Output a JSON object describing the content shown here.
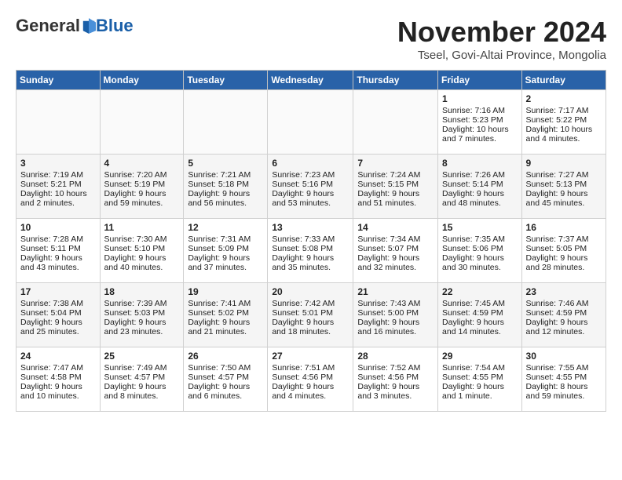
{
  "header": {
    "logo_general": "General",
    "logo_blue": "Blue",
    "month_title": "November 2024",
    "location": "Tseel, Govi-Altai Province, Mongolia"
  },
  "weekdays": [
    "Sunday",
    "Monday",
    "Tuesday",
    "Wednesday",
    "Thursday",
    "Friday",
    "Saturday"
  ],
  "weeks": [
    [
      {
        "day": "",
        "content": ""
      },
      {
        "day": "",
        "content": ""
      },
      {
        "day": "",
        "content": ""
      },
      {
        "day": "",
        "content": ""
      },
      {
        "day": "",
        "content": ""
      },
      {
        "day": "1",
        "content": "Sunrise: 7:16 AM\nSunset: 5:23 PM\nDaylight: 10 hours and 7 minutes."
      },
      {
        "day": "2",
        "content": "Sunrise: 7:17 AM\nSunset: 5:22 PM\nDaylight: 10 hours and 4 minutes."
      }
    ],
    [
      {
        "day": "3",
        "content": "Sunrise: 7:19 AM\nSunset: 5:21 PM\nDaylight: 10 hours and 2 minutes."
      },
      {
        "day": "4",
        "content": "Sunrise: 7:20 AM\nSunset: 5:19 PM\nDaylight: 9 hours and 59 minutes."
      },
      {
        "day": "5",
        "content": "Sunrise: 7:21 AM\nSunset: 5:18 PM\nDaylight: 9 hours and 56 minutes."
      },
      {
        "day": "6",
        "content": "Sunrise: 7:23 AM\nSunset: 5:16 PM\nDaylight: 9 hours and 53 minutes."
      },
      {
        "day": "7",
        "content": "Sunrise: 7:24 AM\nSunset: 5:15 PM\nDaylight: 9 hours and 51 minutes."
      },
      {
        "day": "8",
        "content": "Sunrise: 7:26 AM\nSunset: 5:14 PM\nDaylight: 9 hours and 48 minutes."
      },
      {
        "day": "9",
        "content": "Sunrise: 7:27 AM\nSunset: 5:13 PM\nDaylight: 9 hours and 45 minutes."
      }
    ],
    [
      {
        "day": "10",
        "content": "Sunrise: 7:28 AM\nSunset: 5:11 PM\nDaylight: 9 hours and 43 minutes."
      },
      {
        "day": "11",
        "content": "Sunrise: 7:30 AM\nSunset: 5:10 PM\nDaylight: 9 hours and 40 minutes."
      },
      {
        "day": "12",
        "content": "Sunrise: 7:31 AM\nSunset: 5:09 PM\nDaylight: 9 hours and 37 minutes."
      },
      {
        "day": "13",
        "content": "Sunrise: 7:33 AM\nSunset: 5:08 PM\nDaylight: 9 hours and 35 minutes."
      },
      {
        "day": "14",
        "content": "Sunrise: 7:34 AM\nSunset: 5:07 PM\nDaylight: 9 hours and 32 minutes."
      },
      {
        "day": "15",
        "content": "Sunrise: 7:35 AM\nSunset: 5:06 PM\nDaylight: 9 hours and 30 minutes."
      },
      {
        "day": "16",
        "content": "Sunrise: 7:37 AM\nSunset: 5:05 PM\nDaylight: 9 hours and 28 minutes."
      }
    ],
    [
      {
        "day": "17",
        "content": "Sunrise: 7:38 AM\nSunset: 5:04 PM\nDaylight: 9 hours and 25 minutes."
      },
      {
        "day": "18",
        "content": "Sunrise: 7:39 AM\nSunset: 5:03 PM\nDaylight: 9 hours and 23 minutes."
      },
      {
        "day": "19",
        "content": "Sunrise: 7:41 AM\nSunset: 5:02 PM\nDaylight: 9 hours and 21 minutes."
      },
      {
        "day": "20",
        "content": "Sunrise: 7:42 AM\nSunset: 5:01 PM\nDaylight: 9 hours and 18 minutes."
      },
      {
        "day": "21",
        "content": "Sunrise: 7:43 AM\nSunset: 5:00 PM\nDaylight: 9 hours and 16 minutes."
      },
      {
        "day": "22",
        "content": "Sunrise: 7:45 AM\nSunset: 4:59 PM\nDaylight: 9 hours and 14 minutes."
      },
      {
        "day": "23",
        "content": "Sunrise: 7:46 AM\nSunset: 4:59 PM\nDaylight: 9 hours and 12 minutes."
      }
    ],
    [
      {
        "day": "24",
        "content": "Sunrise: 7:47 AM\nSunset: 4:58 PM\nDaylight: 9 hours and 10 minutes."
      },
      {
        "day": "25",
        "content": "Sunrise: 7:49 AM\nSunset: 4:57 PM\nDaylight: 9 hours and 8 minutes."
      },
      {
        "day": "26",
        "content": "Sunrise: 7:50 AM\nSunset: 4:57 PM\nDaylight: 9 hours and 6 minutes."
      },
      {
        "day": "27",
        "content": "Sunrise: 7:51 AM\nSunset: 4:56 PM\nDaylight: 9 hours and 4 minutes."
      },
      {
        "day": "28",
        "content": "Sunrise: 7:52 AM\nSunset: 4:56 PM\nDaylight: 9 hours and 3 minutes."
      },
      {
        "day": "29",
        "content": "Sunrise: 7:54 AM\nSunset: 4:55 PM\nDaylight: 9 hours and 1 minute."
      },
      {
        "day": "30",
        "content": "Sunrise: 7:55 AM\nSunset: 4:55 PM\nDaylight: 8 hours and 59 minutes."
      }
    ]
  ]
}
